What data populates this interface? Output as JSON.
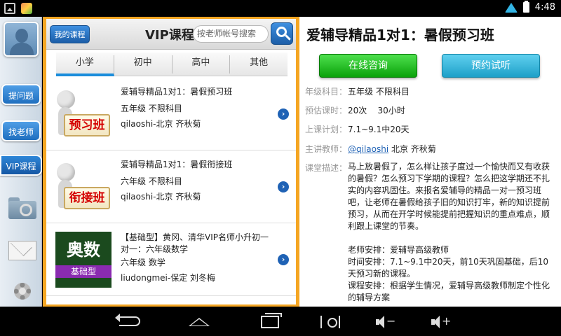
{
  "status_bar": {
    "time": "4:48"
  },
  "left_nav": {
    "items": [
      {
        "label": "提问题"
      },
      {
        "label": "找老师"
      },
      {
        "label": "VIP课程"
      }
    ],
    "icons": [
      "folder-icon",
      "mail-icon",
      "gear-icon"
    ]
  },
  "list_panel": {
    "my_course_label": "我的课程",
    "title": "VIP课程",
    "search_placeholder": "按老师帐号搜索",
    "tabs": [
      {
        "label": "小学",
        "active": true
      },
      {
        "label": "初中",
        "active": false
      },
      {
        "label": "高中",
        "active": false
      },
      {
        "label": "其他",
        "active": false
      }
    ],
    "items": [
      {
        "thumb_text": "预习班",
        "title": "爱辅导精品1对1：暑假预习班",
        "grade": "五年级 不限科目",
        "teacher": "qilaoshi-北京 齐秋菊"
      },
      {
        "thumb_text": "衔接班",
        "title": "爱辅导精品1对1：暑假衔接班",
        "grade": "六年级 不限科目",
        "teacher": "qilaoshi-北京 齐秋菊"
      },
      {
        "thumb_title": "奥数",
        "thumb_band": "基础型",
        "title": "【基础型】黄冈、清华VIP名师小升初一对一：六年级数学",
        "grade": "六年级 数学",
        "teacher": "liudongmei-保定 刘冬梅"
      }
    ]
  },
  "detail": {
    "title": "爱辅导精品1对1：暑假预习班",
    "consult_label": "在线咨询",
    "trial_label": "预约试听",
    "fields": [
      {
        "label": "年级科目：",
        "value": "五年级 不限科目"
      },
      {
        "label": "预估课时：",
        "value": "20次    30小时"
      },
      {
        "label": "上课计划：",
        "value": "7.1~9.1中20天"
      }
    ],
    "teacher_label": "主讲教师：",
    "teacher_link": "@qilaoshi",
    "teacher_rest": " 北京 齐秋菊",
    "desc_label": "课堂描述：",
    "desc": "马上放暑假了，怎么样让孩子度过一个愉快而又有收获的暑假？怎么预习下学期的课程？怎么把这学期还不扎实的内容巩固住。来报名爱辅导的精品一对一预习班吧，让老师在暑假给孩子旧的知识打牢，新的知识提前预习，从而在开学时候能提前把握知识的重点难点，顺利跟上课堂的节奏。\n\n老师安排：爱辅导高级教师\n时间安排：7.1~9.1中20天，前10天巩固基础，后10天预习新的课程。\n课程安排：根据学生情况，爱辅导高级教师制定个性化的辅导方案"
  }
}
